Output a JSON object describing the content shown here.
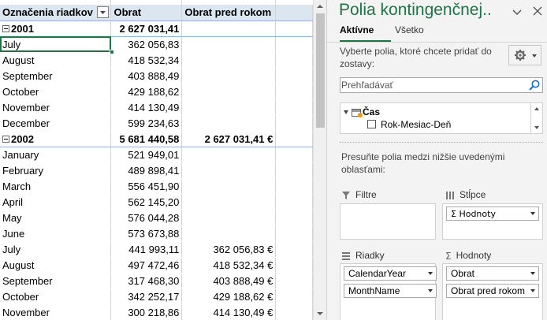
{
  "pivot": {
    "headers": [
      "Označenia riadkov",
      "Obrat",
      "Obrat pred rokom"
    ],
    "rows": [
      {
        "type": "year",
        "label": "2001",
        "obrat": "2 627 031,41",
        "prev": ""
      },
      {
        "type": "month",
        "label": "July",
        "obrat": "362 056,83",
        "prev": ""
      },
      {
        "type": "month",
        "label": "August",
        "obrat": "418 532,34",
        "prev": ""
      },
      {
        "type": "month",
        "label": "September",
        "obrat": "403 888,49",
        "prev": ""
      },
      {
        "type": "month",
        "label": "October",
        "obrat": "429 188,62",
        "prev": ""
      },
      {
        "type": "month",
        "label": "November",
        "obrat": "414 130,49",
        "prev": ""
      },
      {
        "type": "month",
        "label": "December",
        "obrat": "599 234,63",
        "prev": ""
      },
      {
        "type": "year",
        "label": "2002",
        "obrat": "5 681 440,58",
        "prev": "2 627 031,41 €"
      },
      {
        "type": "month",
        "label": "January",
        "obrat": "521 949,01",
        "prev": ""
      },
      {
        "type": "month",
        "label": "February",
        "obrat": "489 898,41",
        "prev": ""
      },
      {
        "type": "month",
        "label": "March",
        "obrat": "556 451,90",
        "prev": ""
      },
      {
        "type": "month",
        "label": "April",
        "obrat": "562 145,20",
        "prev": ""
      },
      {
        "type": "month",
        "label": "May",
        "obrat": "576 044,28",
        "prev": ""
      },
      {
        "type": "month",
        "label": "June",
        "obrat": "573 673,88",
        "prev": ""
      },
      {
        "type": "month",
        "label": "July",
        "obrat": "441 993,11",
        "prev": "362 056,83 €"
      },
      {
        "type": "month",
        "label": "August",
        "obrat": "497 472,46",
        "prev": "418 532,34 €"
      },
      {
        "type": "month",
        "label": "September",
        "obrat": "317 468,30",
        "prev": "403 888,49 €"
      },
      {
        "type": "month",
        "label": "October",
        "obrat": "342 252,17",
        "prev": "429 188,62 €"
      },
      {
        "type": "month",
        "label": "November",
        "obrat": "300 218,86",
        "prev": "414 130,49 €"
      }
    ]
  },
  "pane": {
    "title": "Polia kontingenčnej..",
    "tabs": [
      "Aktívne",
      "Všetko"
    ],
    "instruction": "Vyberte polia, ktoré chcete pridať do zostavy:",
    "search_placeholder": "Prehľadávať",
    "tree": {
      "table": "Čas",
      "field": "Rok-Mesiac-Deň"
    },
    "drag_instruction": "Presuňte polia medzi nižšie uvedenými oblasťami:",
    "areas": {
      "filters": {
        "label": "Filtre",
        "items": []
      },
      "columns": {
        "label": "Stĺpce",
        "items": [
          "Σ Hodnoty"
        ]
      },
      "rows": {
        "label": "Riadky",
        "items": [
          "CalendarYear",
          "MonthName"
        ]
      },
      "values": {
        "label": "Hodnoty",
        "items": [
          "Obrat",
          "Obrat pred rokom"
        ]
      }
    }
  },
  "colors": {
    "accent": "#217346",
    "header_fill": "#dce6f1",
    "pane_bg": "#f3f3f3"
  }
}
